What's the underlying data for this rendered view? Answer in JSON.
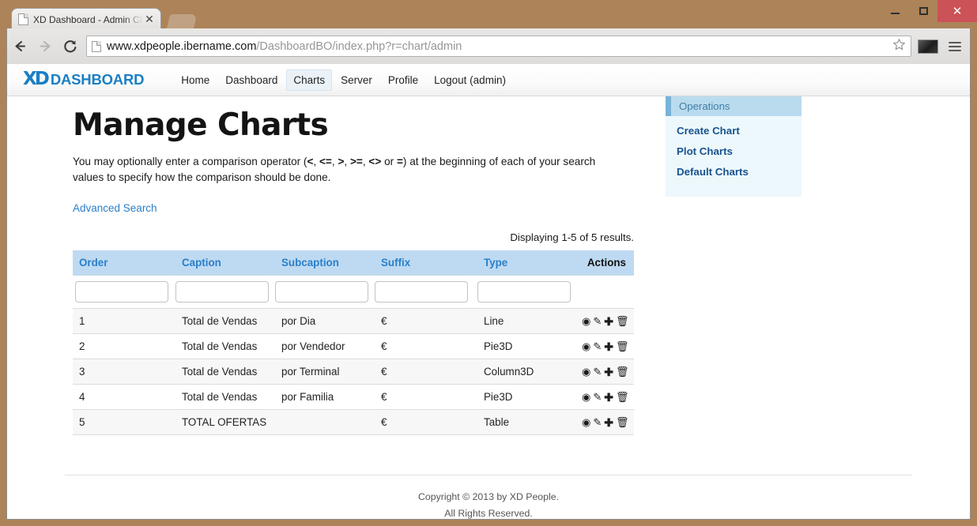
{
  "browser": {
    "tab_title": "XD Dashboard - Admin Ch",
    "tab_close_glyph": "✕",
    "new_tab_label": "",
    "window_controls": {
      "minimize": "",
      "maximize": "",
      "close": "✕"
    },
    "url": {
      "host": "www.xdpeople.ibername.com",
      "path": "/DashboardBO/index.php?r=chart/admin"
    },
    "bookmark_glyph": "☆"
  },
  "site": {
    "logo_mark": "XD",
    "logo_text": "DASHBOARD",
    "nav": [
      {
        "label": "Home",
        "active": false
      },
      {
        "label": "Dashboard",
        "active": false
      },
      {
        "label": "Charts",
        "active": true
      },
      {
        "label": "Server",
        "active": false
      },
      {
        "label": "Profile",
        "active": false
      },
      {
        "label": "Logout (admin)",
        "active": false
      }
    ]
  },
  "page": {
    "title": "Manage Charts",
    "intro_prefix": "You may optionally enter a comparison operator (",
    "operators": [
      "<",
      "<=",
      ">",
      ">=",
      "<>"
    ],
    "intro_middle": " or ",
    "operator_equals": "=",
    "intro_suffix": ") at the beginning of each of your search values to specify how the comparison should be done.",
    "advanced_search": "Advanced Search",
    "results_summary": "Displaying 1-5 of 5 results."
  },
  "table": {
    "columns": [
      "Order",
      "Caption",
      "Subcaption",
      "Suffix",
      "Type"
    ],
    "actions_header": "Actions",
    "filter_placeholders": [
      "",
      "",
      "",
      "",
      ""
    ],
    "filter_values": [
      "",
      "",
      "",
      "",
      ""
    ],
    "action_icons": [
      {
        "name": "view-icon",
        "glyph": "◉"
      },
      {
        "name": "edit-icon",
        "glyph": "✎"
      },
      {
        "name": "add-icon",
        "glyph": "✚"
      },
      {
        "name": "delete-icon",
        "glyph": "🗑"
      }
    ],
    "rows": [
      {
        "order": "1",
        "caption": "Total de Vendas",
        "subcaption": "por Dia",
        "suffix": "€",
        "type": "Line"
      },
      {
        "order": "2",
        "caption": "Total de Vendas",
        "subcaption": "por Vendedor",
        "suffix": "€",
        "type": "Pie3D"
      },
      {
        "order": "3",
        "caption": "Total de Vendas",
        "subcaption": "por Terminal",
        "suffix": "€",
        "type": "Column3D"
      },
      {
        "order": "4",
        "caption": "Total de Vendas",
        "subcaption": "por Familia",
        "suffix": "€",
        "type": "Pie3D"
      },
      {
        "order": "5",
        "caption": "TOTAL OFERTAS",
        "subcaption": "",
        "suffix": "€",
        "type": "Table"
      }
    ]
  },
  "sidebar": {
    "header": "Operations",
    "items": [
      {
        "label": "Create Chart"
      },
      {
        "label": "Plot Charts"
      },
      {
        "label": "Default Charts"
      }
    ]
  },
  "footer": {
    "line1": "Copyright © 2013 by XD People.",
    "line2": "All Rights Reserved."
  },
  "colors": {
    "brand_blue": "#1b7fc4",
    "link_blue": "#2a7fc9",
    "table_header_bg": "#bedaf2",
    "sidebar_bg": "#edf8fc",
    "sidebar_header_bg": "#badbee",
    "sidebar_accent": "#79b3d8",
    "window_chrome": "#ad8359",
    "close_button": "#cb5257"
  }
}
